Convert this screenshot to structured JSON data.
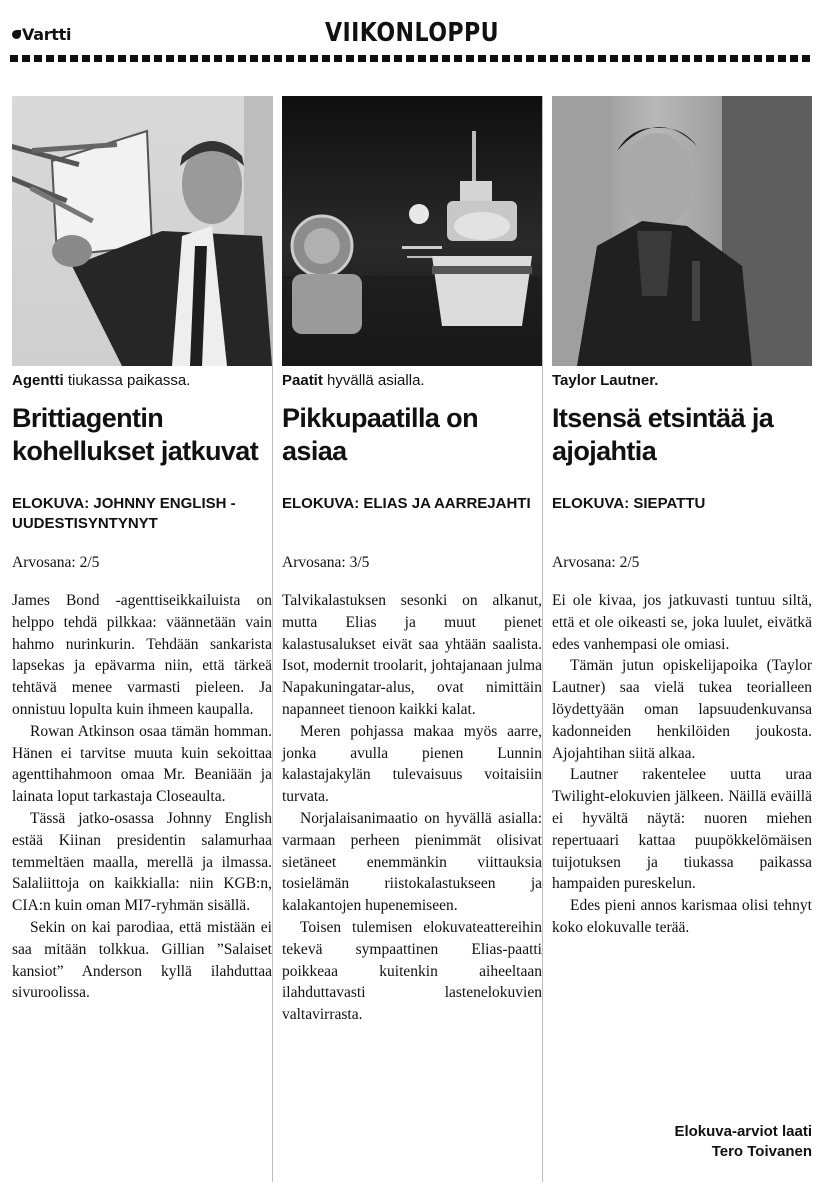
{
  "header": {
    "logo": "Vartti",
    "section": "VIIKONLOPPU"
  },
  "articles": [
    {
      "caption_bold": "Agentti",
      "caption_rest": " tiukassa paikassa.",
      "headline": "Brittiagentin kohellukset jatkuvat",
      "kicker": "ELOKUVA: JOHNNY ENGLISH - UUDESTISYNTYNYT",
      "grade": "Arvosana: 2/5",
      "paragraphs": [
        "James Bond -agenttiseikkailuista on helppo tehdä pilkkaa: väännetään vain hahmo nurinkurin. Tehdään sankarista lapsekas ja epävarma niin, että tärkeä tehtävä menee varmasti pieleen. Ja onnistuu lopulta kuin ihmeen kaupalla.",
        "Rowan Atkinson osaa tämän homman. Hänen ei tarvitse muuta kuin sekoittaa agenttihahmoon omaa Mr. Beaniään ja lainata loput tarkastaja Closeaulta.",
        "Tässä jatko-osassa Johnny English estää Kiinan presidentin salamurhaa temmeltäen maalla, merellä ja ilmassa. Salaliittoja on kaikkialla: niin KGB:n, CIA:n kuin oman MI7-ryhmän sisällä.",
        "Sekin on kai parodiaa, että mistään ei saa mitään tolkkua. Gillian ”Salaiset kansiot” Anderson kyllä ilahduttaa sivuroolissa."
      ]
    },
    {
      "caption_bold": "Paatit",
      "caption_rest": " hyvällä asialla.",
      "headline": "Pikkupaatilla on asiaa",
      "kicker": "ELOKUVA: ELIAS JA AARREJAHTI",
      "grade": "Arvosana: 3/5",
      "paragraphs": [
        "Talvikalastuksen sesonki on alkanut, mutta Elias ja muut pienet kalastusalukset eivät saa yhtään saalista. Isot, modernit troolarit, johtajanaan julma Napakuningatar-alus, ovat nimittäin napanneet tienoon kaikki kalat.",
        "Meren pohjassa makaa myös aarre, jonka avulla pienen Lunnin kalastajakylän tulevaisuus voitaisiin turvata.",
        "Norjalaisanimaatio on hyvällä asialla: varmaan perheen pienimmät olisivat sietäneet enemmänkin viittauksia tosielämän riistokalastukseen ja kalakantojen hupenemiseen.",
        "Toisen tulemisen elokuvateattereihin tekevä sympaattinen Elias-paatti poikkeaa kuitenkin aiheeltaan ilahduttavasti lastenelokuvien valtavirrasta."
      ]
    },
    {
      "caption_bold": "Taylor Lautner.",
      "caption_rest": "",
      "headline": "Itsensä etsintää ja ajojahtia",
      "kicker": "ELOKUVA: SIEPATTU",
      "grade": "Arvosana: 2/5",
      "paragraphs": [
        "Ei ole kivaa, jos jatkuvasti tuntuu siltä, että et ole oikeasti se, joka luulet, eivätkä edes vanhempasi ole omiasi.",
        "Tämän jutun opiskelijapoika (Taylor Lautner) saa vielä tukea teorialleen löydettyään oman lapsuudenkuvansa kadonneiden henkilöiden joukosta. Ajojahtihan siitä alkaa.",
        "Lautner rakentelee uutta uraa Twilight-elokuvien jälkeen. Näillä eväillä ei hyvältä näytä: nuoren miehen repertuaari kattaa puupökkelömäisen tuijotuksen ja tiukassa paikassa hampaiden pureskelun.",
        "Edes pieni annos karismaa olisi tehnyt koko elokuvalle terää."
      ]
    }
  ],
  "credit": {
    "line1": "Elokuva-arviot laati",
    "line2": "Tero Toivanen"
  }
}
